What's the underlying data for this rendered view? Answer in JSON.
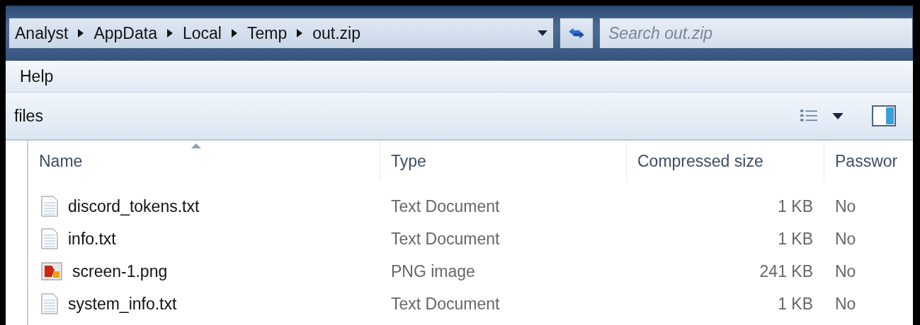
{
  "address_bar": {
    "breadcrumbs": [
      "Analyst",
      "AppData",
      "Local",
      "Temp",
      "out.zip"
    ]
  },
  "search": {
    "placeholder": "Search out.zip"
  },
  "menu_bar": {
    "items": [
      "Help"
    ]
  },
  "toolbar": {
    "label": "files"
  },
  "table": {
    "columns": [
      {
        "label": "Name",
        "sorted": true
      },
      {
        "label": "Type",
        "sorted": false
      },
      {
        "label": "Compressed size",
        "sorted": false
      },
      {
        "label": "Passwor",
        "sorted": false
      }
    ],
    "rows": [
      {
        "kind": "text",
        "name": "discord_tokens.txt",
        "type": "Text Document",
        "size": "1 KB",
        "password": "No"
      },
      {
        "kind": "text",
        "name": "info.txt",
        "type": "Text Document",
        "size": "1 KB",
        "password": "No"
      },
      {
        "kind": "image",
        "name": "screen-1.png",
        "type": "PNG image",
        "size": "241 KB",
        "password": "No"
      },
      {
        "kind": "text",
        "name": "system_info.txt",
        "type": "Text Document",
        "size": "1 KB",
        "password": "No"
      }
    ]
  }
}
